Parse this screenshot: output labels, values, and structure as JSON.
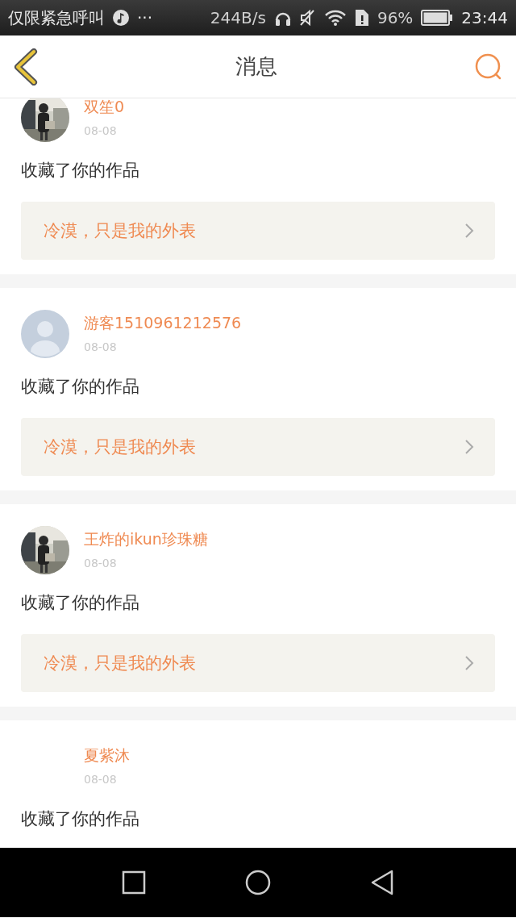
{
  "status_bar": {
    "carrier": "仅限紧急呼叫",
    "more": "···",
    "speed": "244B/s",
    "battery": "96%",
    "time": "23:44"
  },
  "header": {
    "title": "消息"
  },
  "messages": [
    {
      "user": "双笙0",
      "date": "08-08",
      "action": "收藏了你的作品",
      "work": "冷漠，只是我的外表"
    },
    {
      "user": "游客1510961212576",
      "date": "08-08",
      "action": "收藏了你的作品",
      "work": "冷漠，只是我的外表",
      "avatar": {
        "kind": "silhouette"
      }
    },
    {
      "user": "王炸的ikun珍珠糖",
      "date": "08-08",
      "action": "收藏了你的作品",
      "work": "冷漠，只是我的外表"
    },
    {
      "user": "夏紫沐",
      "date": "08-08",
      "action": "收藏了你的作品"
    }
  ]
}
